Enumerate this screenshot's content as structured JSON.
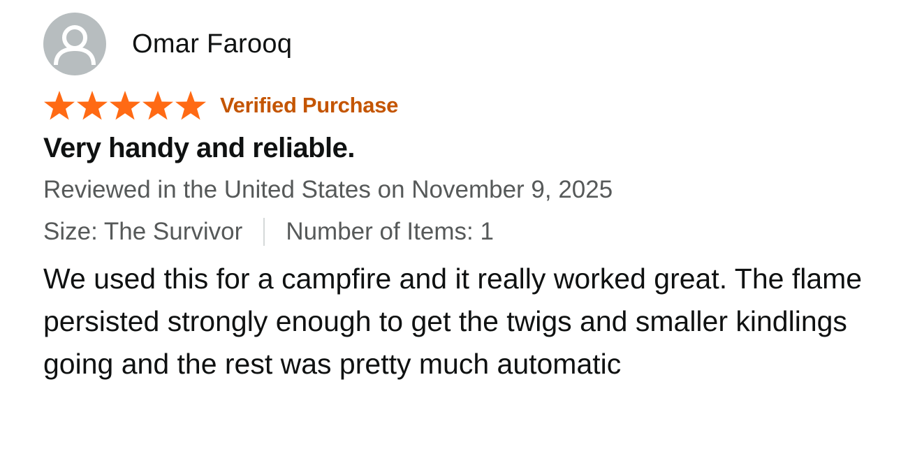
{
  "reviewer": {
    "name": "Omar Farooq",
    "avatar_icon": "user-silhouette-icon",
    "avatar_color": "#b7bdbf"
  },
  "rating": {
    "stars": 5,
    "max_stars": 5,
    "star_icon": "star-icon",
    "star_color": "#ff6a14",
    "verified_label": "Verified Purchase",
    "verified_color": "#c45500"
  },
  "review": {
    "title": "Very handy and reliable.",
    "date_line": "Reviewed in the United States on November 9, 2025",
    "size_label": "Size: The Survivor",
    "items_label": "Number of Items: 1",
    "body": "We used this for a campfire and it really worked great. The flame persisted strongly enough to get the twigs and smaller kindlings going and the rest was pretty much automatic"
  }
}
